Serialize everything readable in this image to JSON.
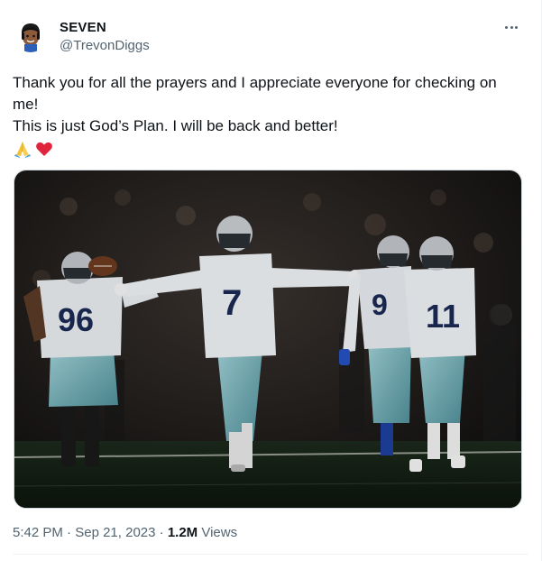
{
  "author": {
    "display_name": "SEVEN",
    "handle": "@TrevonDiggs"
  },
  "tweet": {
    "lines": [
      "Thank you for all the prayers and I appreciate everyone for checking on me!",
      "This is just God’s Plan. I will be back and better!"
    ],
    "emojis": [
      "praying-hands-icon",
      "red-heart-icon"
    ]
  },
  "media": {
    "alt": "",
    "jersey_numbers": [
      "96",
      "7",
      "9",
      "11"
    ]
  },
  "meta": {
    "time": "5:42 PM",
    "separator": "·",
    "date": "Sep 21, 2023",
    "views_count": "1.2M",
    "views_label": "Views"
  },
  "colors": {
    "text": "#0f1419",
    "secondary": "#536471",
    "jersey_navy": "#1b2a55",
    "pants_teal": "#6aa9b3"
  }
}
